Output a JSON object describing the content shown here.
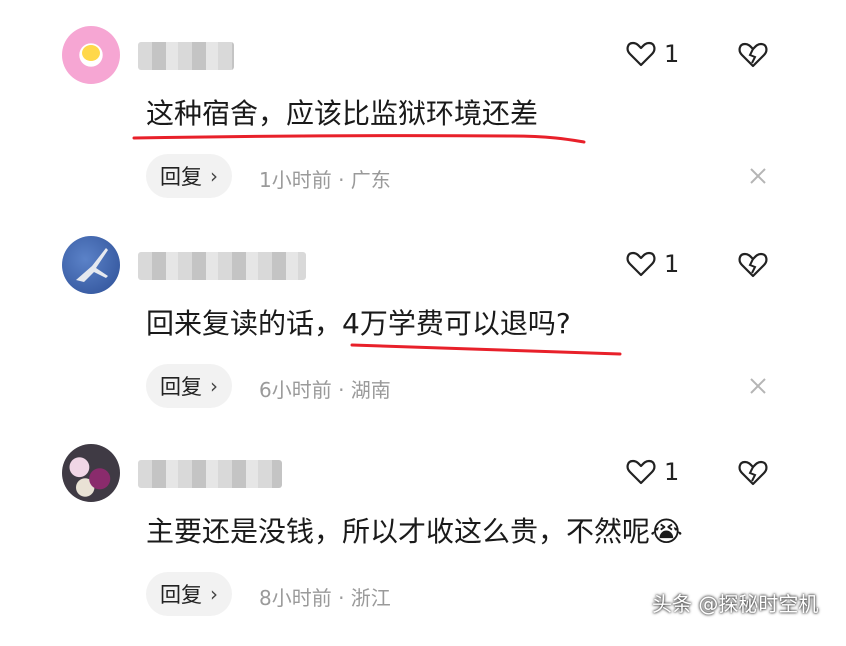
{
  "comments": [
    {
      "text": "这种宿舍，应该比监狱环境还差",
      "like_count": "1",
      "reply_label": "回复",
      "meta": "1小时前 · 广东"
    },
    {
      "text": "回来复读的话，4万学费可以退吗?",
      "like_count": "1",
      "reply_label": "回复",
      "meta": "6小时前 · 湖南"
    },
    {
      "text": "主要还是没钱，所以才收这么贵，不然呢",
      "emoji": "😭",
      "like_count": "1",
      "reply_label": "回复",
      "meta": "8小时前 · 浙江"
    }
  ],
  "watermark": "头条 @探秘时空机",
  "colors": {
    "underline": "#e8202a",
    "reply_bg": "#f2f2f2",
    "meta": "#9a9a9a"
  },
  "icons": [
    "heart-icon",
    "broken-heart-icon",
    "close-icon",
    "chevron-right-icon"
  ]
}
